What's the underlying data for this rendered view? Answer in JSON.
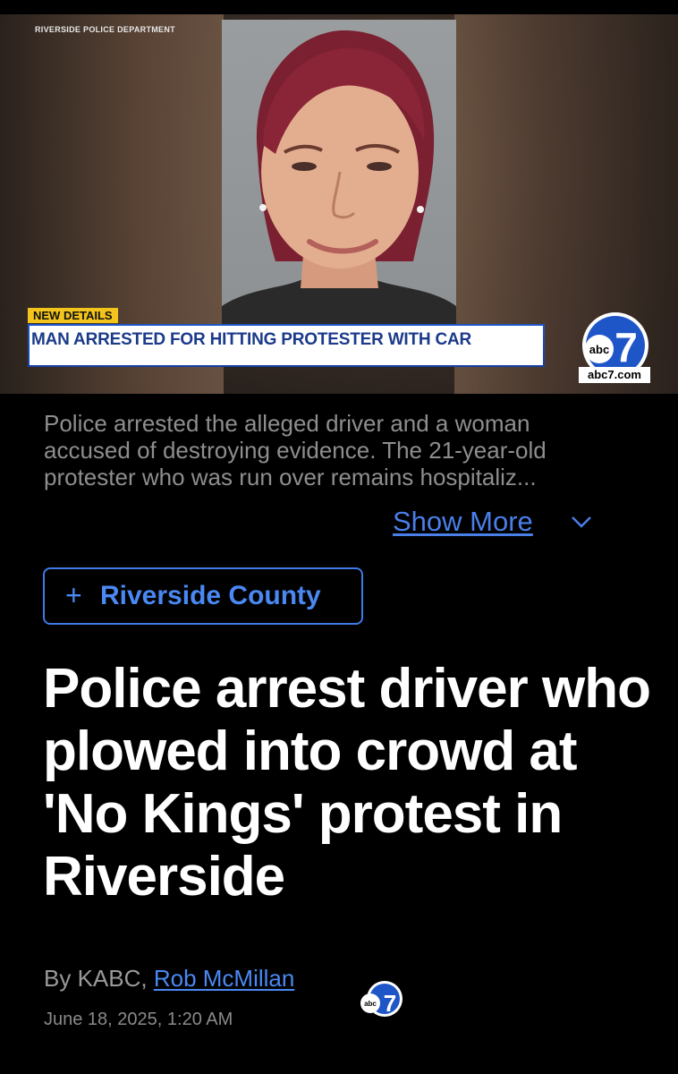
{
  "hero": {
    "credit": "RIVERSIDE POLICE DEPARTMENT",
    "tag": "NEW DETAILS",
    "banner": "MAN ARRESTED FOR HITTING PROTESTER WITH CAR",
    "logo_text": "abc",
    "logo_number": "7",
    "site": "abc7.com"
  },
  "summary": {
    "text": "Police arrested the alleged driver and a woman accused of destroying evidence. The 21-year-old protester who was run over remains hospitaliz...",
    "show_more": "Show More"
  },
  "topic": {
    "plus": "+",
    "label": "Riverside County"
  },
  "article": {
    "title": "Police arrest driver who plowed into crowd at 'No Kings' protest in Riverside",
    "by_prefix": "By KABC, ",
    "author": "Rob McMillan",
    "date": "June 18, 2025, 1:20 AM"
  },
  "colors": {
    "accent": "#4a88f2",
    "tag_yellow": "#f3c41b",
    "banner_blue": "#1440a8"
  }
}
